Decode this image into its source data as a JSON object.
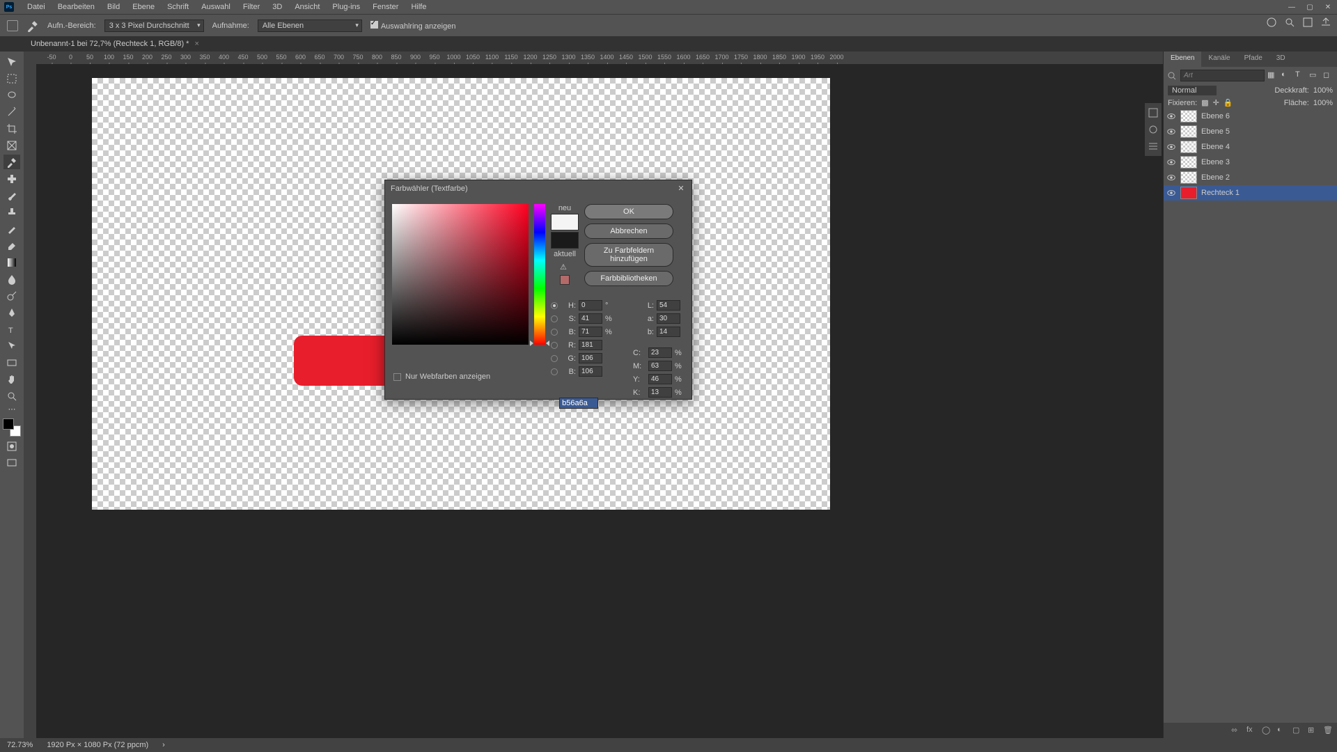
{
  "menu": {
    "items": [
      "Datei",
      "Bearbeiten",
      "Bild",
      "Ebene",
      "Schrift",
      "Auswahl",
      "Filter",
      "3D",
      "Ansicht",
      "Plug-ins",
      "Fenster",
      "Hilfe"
    ]
  },
  "optbar": {
    "range_label": "Aufn.-Bereich:",
    "range_value": "3 x 3 Pixel Durchschnitt",
    "sample_label": "Aufnahme:",
    "sample_value": "Alle Ebenen",
    "show_sel": "Auswahlring anzeigen"
  },
  "tab": {
    "title": "Unbenannt-1 bei 72,7% (Rechteck 1, RGB/8) *"
  },
  "ruler": {
    "ticks": [
      "-50",
      "0",
      "50",
      "100",
      "150",
      "200",
      "250",
      "300",
      "350",
      "400",
      "450",
      "500",
      "550",
      "600",
      "650",
      "700",
      "750",
      "800",
      "850",
      "900",
      "950",
      "1000",
      "1050",
      "1100",
      "1150",
      "1200",
      "1250",
      "1300",
      "1350",
      "1400",
      "1450",
      "1500",
      "1550",
      "1600",
      "1650",
      "1700",
      "1750",
      "1800",
      "1850",
      "1900",
      "1950",
      "2000"
    ]
  },
  "panels": {
    "tabs": [
      "Ebenen",
      "Kanäle",
      "Pfade",
      "3D"
    ],
    "search_ph": "Art",
    "blend": "Normal",
    "opacity_label": "Deckkraft:",
    "opacity_value": "100%",
    "lock_label": "Fixieren:",
    "fill_label": "Fläche:",
    "fill_value": "100%",
    "layers": [
      {
        "name": "Ebene 6"
      },
      {
        "name": "Ebene 5"
      },
      {
        "name": "Ebene 4"
      },
      {
        "name": "Ebene 3"
      },
      {
        "name": "Ebene 2"
      },
      {
        "name": "Rechteck 1",
        "sel": true,
        "shape": true
      }
    ]
  },
  "status": {
    "zoom": "72.73%",
    "info": "1920 Px × 1080 Px (72 ppcm)"
  },
  "dialog": {
    "title": "Farbwähler (Textfarbe)",
    "new": "neu",
    "current": "aktuell",
    "ok": "OK",
    "cancel": "Abbrechen",
    "add": "Zu Farbfeldern hinzufügen",
    "libs": "Farbbibliotheken",
    "webonly": "Nur Webfarben anzeigen",
    "H": "0",
    "S": "41",
    "Bv": "71",
    "R": "181",
    "G": "106",
    "Bb": "106",
    "L": "54",
    "a": "30",
    "b": "14",
    "C": "23",
    "M": "63",
    "Y": "46",
    "K": "13",
    "hex": "b56a6a",
    "new_color": "#f5f5f5",
    "cur_color": "#1a1a1a",
    "deg": "°",
    "pct": "%",
    "hash": "#"
  }
}
